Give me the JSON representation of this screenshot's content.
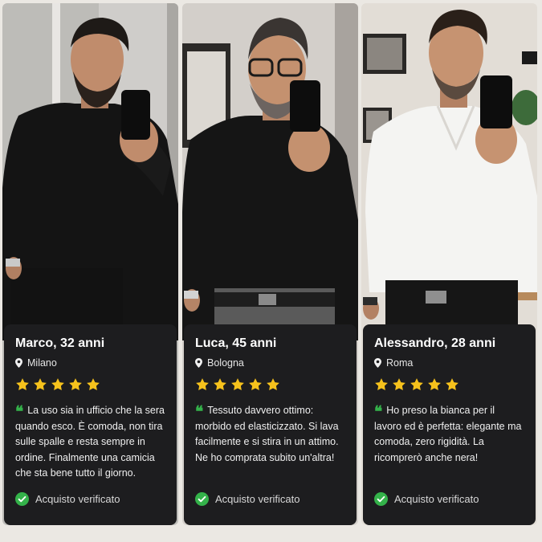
{
  "reviews": [
    {
      "name": "Marco, 32 anni",
      "location": "Milano",
      "rating": 5,
      "shirt_color": "black",
      "quote": "La uso sia in ufficio che la sera quando esco. È comoda, non tira sulle spalle e resta sempre in ordine. Finalmente una camicia che sta bene tutto il giorno.",
      "verified_label": "Acquisto verificato"
    },
    {
      "name": "Luca, 45 anni",
      "location": "Bologna",
      "rating": 5,
      "shirt_color": "black",
      "quote": "Tessuto davvero ottimo: morbido ed elasticizzato. Si lava facilmente e si stira in un attimo. Ne ho comprata subito un'altra!",
      "verified_label": "Acquisto verificato"
    },
    {
      "name": "Alessandro, 28 anni",
      "location": "Roma",
      "rating": 5,
      "shirt_color": "white",
      "quote": "Ho preso la bianca per il lavoro ed è perfetta: elegante ma comoda, zero rigidità. La ricomprerò anche nera!",
      "verified_label": "Acquisto verificato"
    }
  ],
  "colors": {
    "card_bg": "#1d1d1f",
    "star": "#f6c21c",
    "accent_green": "#34b24a"
  }
}
